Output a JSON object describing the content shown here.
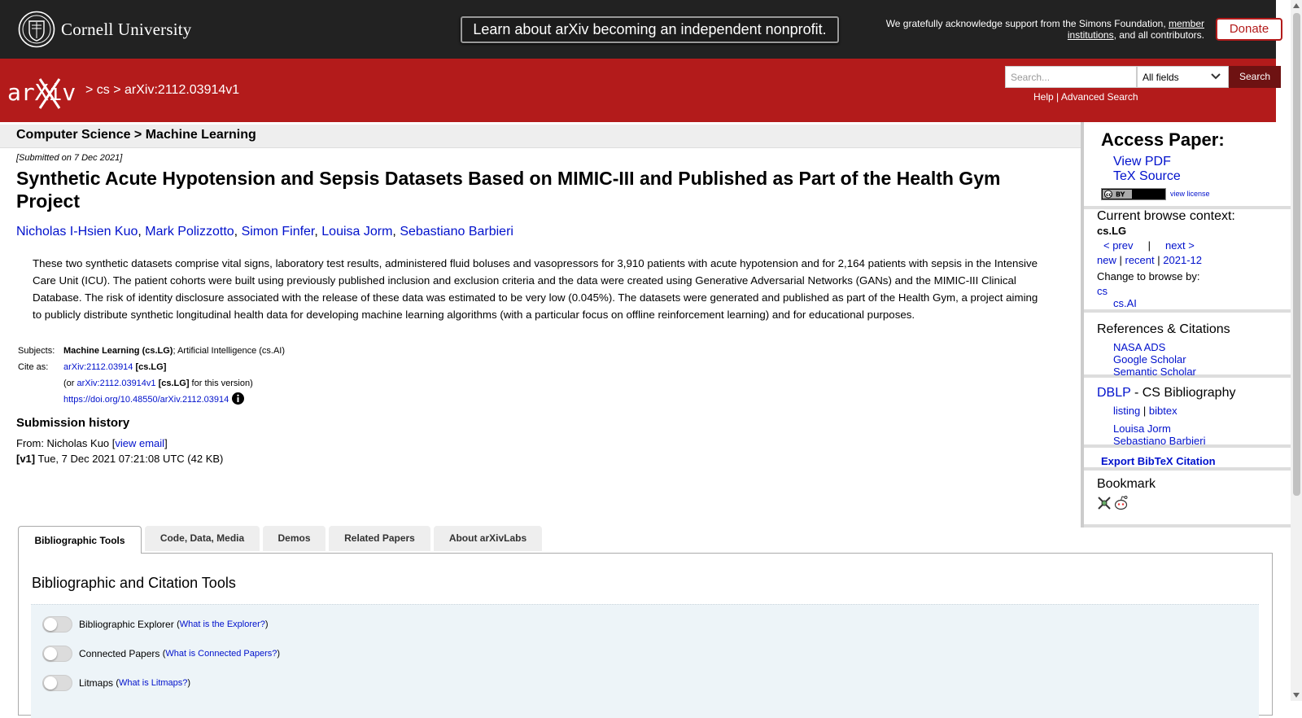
{
  "topbar": {
    "institution": "Cornell University",
    "nonprofit_banner": "Learn about arXiv becoming an independent nonprofit.",
    "ack_prefix": "We gratefully acknowledge support from the Simons Foundation, ",
    "ack_link": "member institutions",
    "ack_suffix": ", and all contributors.",
    "donate": "Donate"
  },
  "header": {
    "logo_text": "arXiv",
    "breadcrumb_sep1": " > ",
    "breadcrumb_cs": "cs",
    "breadcrumb_sep2": " > ",
    "breadcrumb_id": "arXiv:2112.03914v1",
    "search_placeholder": "Search...",
    "search_field_selected": "All fields",
    "search_button": "Search",
    "help": "Help",
    "link_sep": " | ",
    "advanced": "Advanced Search"
  },
  "subject_header": "Computer Science > Machine Learning",
  "paper": {
    "submitted": "[Submitted on 7 Dec 2021]",
    "title": "Synthetic Acute Hypotension and Sepsis Datasets Based on MIMIC-III and Published as Part of the Health Gym Project",
    "authors": [
      "Nicholas I-Hsien Kuo",
      "Mark Polizzotto",
      "Simon Finfer",
      "Louisa Jorm",
      "Sebastiano Barbieri"
    ],
    "author_sep": ", ",
    "abstract": "These two synthetic datasets comprise vital signs, laboratory test results, administered fluid boluses and vasopressors for 3,910 patients with acute hypotension and for 2,164 patients with sepsis in the Intensive Care Unit (ICU). The patient cohorts were built using previously published inclusion and exclusion criteria and the data were created using Generative Adversarial Networks (GANs) and the MIMIC-III Clinical Database. The risk of identity disclosure associated with the release of these data was estimated to be very low (0.045%). The datasets were generated and published as part of the Health Gym, a project aiming to publicly distribute synthetic longitudinal health data for developing machine learning algorithms (with a particular focus on offline reinforcement learning) and for educational purposes.",
    "subjects_label": "Subjects:",
    "subjects_primary": "Machine Learning (cs.LG)",
    "subjects_rest": "; Artificial Intelligence (cs.AI)",
    "cite_label": "Cite as:",
    "cite_id": "arXiv:2112.03914",
    "cite_class": " [cs.LG]",
    "cite_version_prefix": "(or ",
    "cite_version_id": "arXiv:2112.03914v1",
    "cite_version_class": " [cs.LG]",
    "cite_version_suffix": " for this version)",
    "doi": "https://doi.org/10.48550/arXiv.2112.03914",
    "history_heading": "Submission history",
    "history_from_prefix": "From: Nicholas Kuo [",
    "history_view_email": "view email",
    "history_from_suffix": "]",
    "history_v1_label": "[v1]",
    "history_v1_text": " Tue, 7 Dec 2021 07:21:08 UTC (42 KB)"
  },
  "sidebar": {
    "access_heading": "Access Paper:",
    "view_pdf": "View PDF",
    "tex_source": "TeX Source",
    "license_badge": "cc by",
    "view_license": "view license",
    "context_heading": "Current browse context:",
    "context_value": "cs.LG",
    "prev": "< prev",
    "pipe": "|",
    "next": "next >",
    "new": "new",
    "recent": "recent",
    "month": "2021-12",
    "change_browse": "Change to browse by:",
    "browse_cs": "cs",
    "browse_csai": "cs.AI",
    "refs_heading": "References & Citations",
    "nasa": "NASA ADS",
    "google": "Google Scholar",
    "semantic": "Semantic Scholar",
    "dblp": "DBLP",
    "dblp_rest": " - CS Bibliography",
    "listing": "listing",
    "bibtex": "bibtex",
    "dblp_author1": "Louisa Jorm",
    "dblp_author2": "Sebastiano Barbieri",
    "export": "Export BibTeX Citation",
    "bookmark_heading": "Bookmark"
  },
  "tabs": [
    "Bibliographic Tools",
    "Code, Data, Media",
    "Demos",
    "Related Papers",
    "About arXivLabs"
  ],
  "tab_panel": {
    "heading": "Bibliographic and Citation Tools",
    "tools": [
      {
        "name": "Bibliographic Explorer",
        "help": "What is the Explorer?"
      },
      {
        "name": "Connected Papers",
        "help": "What is Connected Papers?"
      },
      {
        "name": "Litmaps",
        "help": "What is Litmaps?"
      }
    ]
  },
  "colors": {
    "arxiv_red": "#b31b1b",
    "topbar": "#222222",
    "link": "#0011cc"
  }
}
